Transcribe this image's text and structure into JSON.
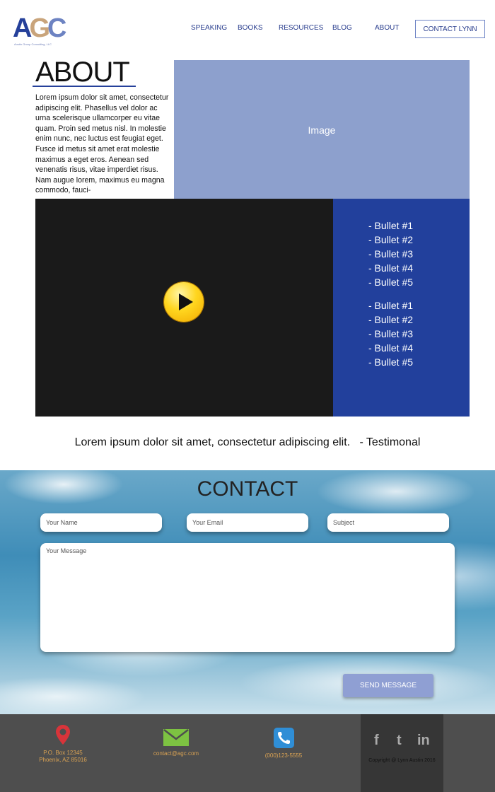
{
  "header": {
    "logo": {
      "letters": [
        "A",
        "G",
        "C"
      ],
      "tagline": "Austin Group Consulting, LLC"
    },
    "nav": [
      "SPEAKING",
      "BOOKS",
      "RESOURCES",
      "BLOG",
      "ABOUT"
    ],
    "contact_button": "CONTACT LYNN"
  },
  "about": {
    "title": "ABOUT",
    "body": "Lorem ipsum dolor sit amet, consectetur adipiscing elit. Phasellus vel dolor ac urna scelerisque ullamcorper eu vitae quam. Proin sed metus nisl. In molestie enim nunc, nec luctus est feugiat eget. Fusce id metus sit amet erat molestie maximus a eget eros. Aenean sed venenatis risus, vitae imperdiet risus. Nam augue lorem, maximus eu magna commodo, fauci-",
    "image_label": "Image"
  },
  "bullets": {
    "group1": [
      "- Bullet #1",
      "- Bullet #2",
      "- Bullet #3",
      "- Bullet #4",
      "- Bullet #5"
    ],
    "group2": [
      "- Bullet #1",
      "- Bullet #2",
      "- Bullet #3",
      "- Bullet #4",
      "- Bullet #5"
    ]
  },
  "testimonial": "Lorem ipsum dolor sit amet, consectetur adipiscing elit.   - Testimonal",
  "contact": {
    "title": "CONTACT",
    "name_placeholder": "Your Name",
    "email_placeholder": "Your Email",
    "subject_placeholder": "Subject",
    "message_placeholder": "Your Message",
    "send_label": "SEND MESSAGE"
  },
  "footer": {
    "address_line1": "P.O. Box 12345",
    "address_line2": "Phoenix, AZ 85016",
    "email": "contact@agc.com",
    "phone": "(000)123-5555",
    "social": {
      "facebook": "f",
      "twitter": "t",
      "linkedin": "in"
    },
    "copyright": "Copyright @ Lynn Austin 2016"
  },
  "colors": {
    "brand_blue": "#22409c",
    "image_blue": "#8da0cd",
    "video_bg": "#1a1a1a",
    "footer_bg": "#4e4e4e",
    "footer_text": "#d9a253",
    "pin_red": "#d8343a",
    "mail_green": "#7dc242",
    "phone_blue": "#2f8ed6"
  },
  "icons": [
    "location-pin-icon",
    "envelope-icon",
    "phone-icon",
    "play-icon",
    "facebook-icon",
    "twitter-icon",
    "linkedin-icon"
  ]
}
